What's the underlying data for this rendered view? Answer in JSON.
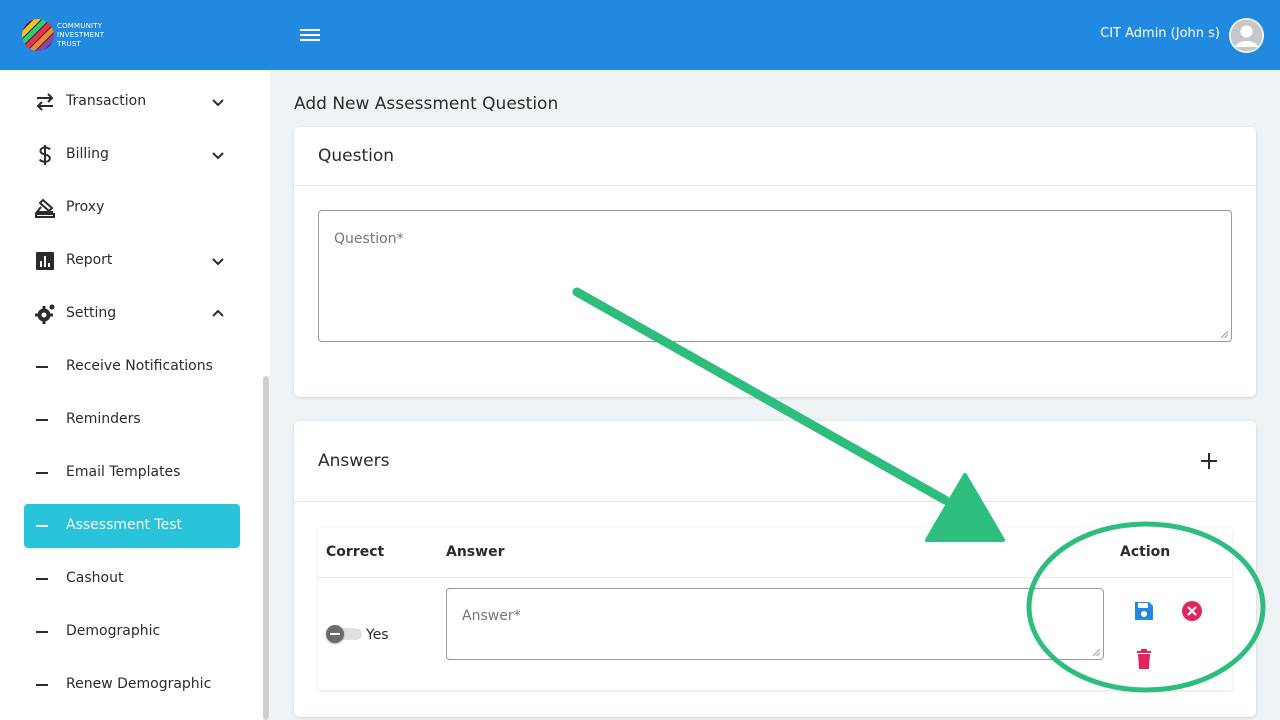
{
  "header": {
    "logo_lines": [
      "COMMUNITY",
      "INVESTMENT",
      "TRUST"
    ],
    "user_name": "CIT Admin (John s)"
  },
  "sidebar": {
    "items": [
      {
        "label": "Transaction",
        "icon": "arrows-swap-icon",
        "chevron": "down"
      },
      {
        "label": "Billing",
        "icon": "dollar-icon",
        "chevron": "down"
      },
      {
        "label": "Proxy",
        "icon": "stamp-icon"
      },
      {
        "label": "Report",
        "icon": "bar-chart-icon",
        "chevron": "down"
      },
      {
        "label": "Setting",
        "icon": "gear-icon",
        "chevron": "up"
      }
    ],
    "sub_items": [
      {
        "label": "Receive Notifications"
      },
      {
        "label": "Reminders"
      },
      {
        "label": "Email Templates"
      },
      {
        "label": "Assessment Test",
        "active": true
      },
      {
        "label": "Cashout"
      },
      {
        "label": "Demographic"
      },
      {
        "label": "Renew Demographic"
      }
    ]
  },
  "main": {
    "page_title": "Add New Assessment Question",
    "question_card": {
      "title": "Question",
      "placeholder": "Question*"
    },
    "answers_card": {
      "title": "Answers",
      "columns": [
        "Correct",
        "Answer",
        "Action"
      ],
      "row": {
        "toggle_label": "Yes",
        "answer_placeholder": "Answer*"
      }
    }
  },
  "colors": {
    "header_bg": "#2189e0",
    "active_item_bg": "#29c4d9",
    "save_icon": "#2189e0",
    "cancel_icon": "#e0245e",
    "delete_icon": "#e0245e",
    "annotation": "#2dbe7e"
  }
}
